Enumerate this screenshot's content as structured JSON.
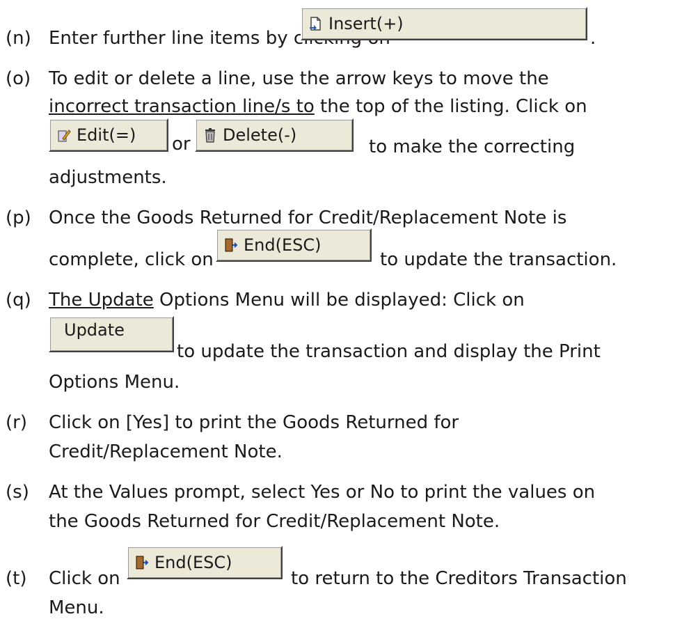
{
  "buttons": {
    "insert": "Insert(+)",
    "edit": "Edit(=)",
    "delete": "Delete(-)",
    "end": "End(ESC)",
    "update": "Update"
  },
  "steps": {
    "n": {
      "label": "(n)",
      "text1": "Enter further line items by clicking on",
      "text2": "."
    },
    "o": {
      "label": "(o)",
      "line1": "To edit or delete a line, use the arrow keys to move the",
      "line2a": "incorrect transaction line/s to",
      "line2b": " the top of the listing. Click on",
      "or": "or",
      "line3": "to make the correcting",
      "line4": "adjustments."
    },
    "p": {
      "label": "(p)",
      "line1": "Once the Goods Returned for Credit/Replacement Note is",
      "line2a": "complete, click on",
      "line2b": "to update the transaction."
    },
    "q": {
      "label": "(q)",
      "line1a": "The Update",
      "line1b": " Options Menu will be displayed:  Click on",
      "line2": "to update the transaction and display the Print",
      "line3": "Options Menu."
    },
    "r": {
      "label": "(r)",
      "line1": "Click on [Yes] to print the Goods Returned for",
      "line2": "Credit/Replacement Note."
    },
    "s": {
      "label": "(s)",
      "line1": "At the Values prompt, select Yes or No to print the values on",
      "line2": "the Goods Returned for Credit/Replacement Note."
    },
    "t": {
      "label": "(t)",
      "line1a": "Click on",
      "line1b": "to return to the Creditors Transaction",
      "line2": "Menu."
    }
  }
}
